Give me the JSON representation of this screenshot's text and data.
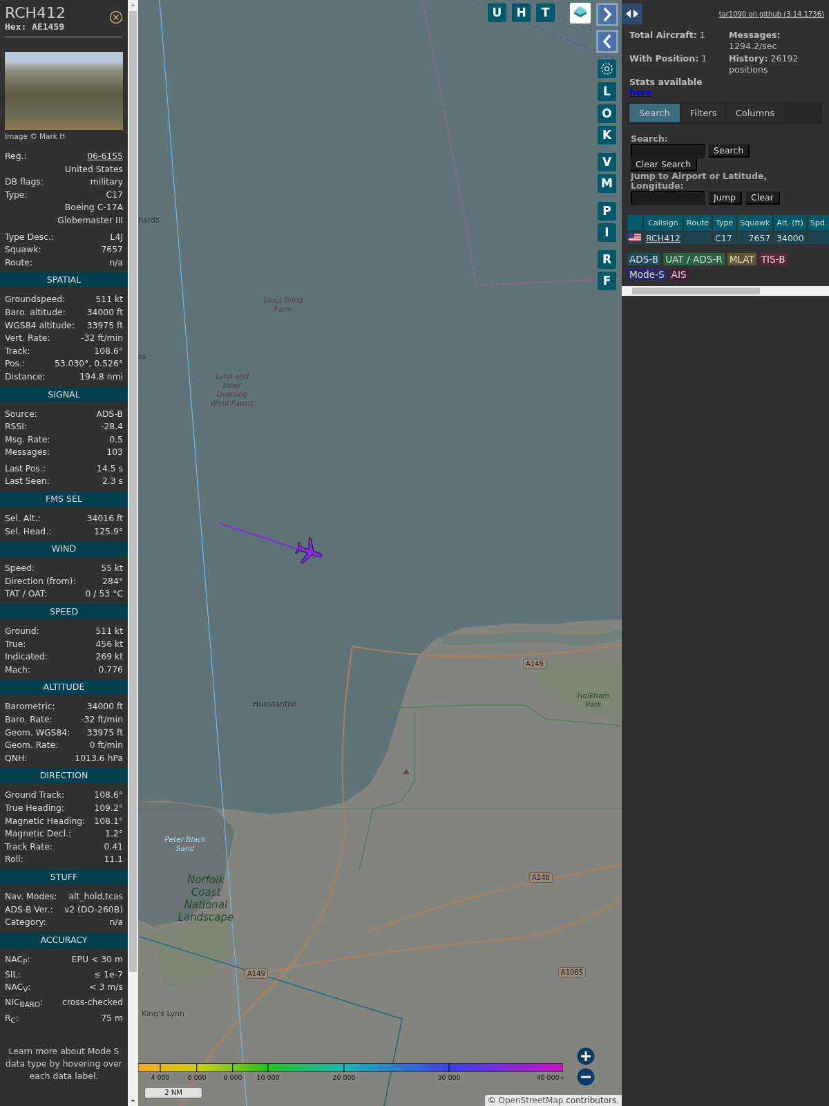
{
  "aircraft_panel": {
    "callsign": "RCH412",
    "hex": "Hex: AE1459",
    "photo_credit": "Image © Mark H",
    "details": [
      [
        {
          "kind": "link",
          "label": "Reg.:",
          "value": "06-6155"
        },
        {
          "kind": "plain",
          "value": "United States"
        },
        {
          "kind": "plain",
          "label": "DB flags:",
          "value": "military"
        },
        {
          "kind": "plain",
          "label": "Type:",
          "value": "C17"
        },
        {
          "kind": "plain",
          "value": "Boeing C-17A Globemaster III"
        }
      ],
      [
        {
          "kind": "plain",
          "label": "Type Desc.:",
          "value": "L4J"
        },
        {
          "kind": "plain",
          "label": "Squawk:",
          "value": "7657"
        },
        {
          "kind": "plain",
          "label": "Route:",
          "value": "n/a"
        }
      ]
    ],
    "sections": [
      {
        "title": "SPATIAL",
        "groups": [
          [
            {
              "label": "Groundspeed:",
              "value": "511 kt"
            },
            {
              "label": "Baro. altitude:",
              "value": "34000 ft"
            },
            {
              "label": "WGS84 altitude:",
              "value": "33975 ft"
            },
            {
              "label": "Vert. Rate:",
              "value": "-32 ft/min"
            },
            {
              "label": "Track:",
              "value": "108.6°"
            },
            {
              "label": "Pos.:",
              "value": "53.030°, 0.526°"
            },
            {
              "label": "Distance:",
              "value": "194.8 nmi"
            }
          ]
        ]
      },
      {
        "title": "SIGNAL",
        "groups": [
          [
            {
              "label": "Source:",
              "value": "ADS-B"
            },
            {
              "label": "RSSI:",
              "value": "-28.4"
            },
            {
              "label": "Msg. Rate:",
              "value": "0.5"
            },
            {
              "label": "Messages:",
              "value": "103"
            }
          ],
          [
            {
              "label": "Last Pos.:",
              "value": "14.5 s"
            },
            {
              "label": "Last Seen:",
              "value": "2.3 s"
            }
          ]
        ]
      },
      {
        "title": "FMS SEL",
        "groups": [
          [
            {
              "label": "Sel. Alt.:",
              "value": "34016 ft"
            },
            {
              "label": "Sel. Head.:",
              "value": "125.9°"
            }
          ]
        ]
      },
      {
        "title": "WIND",
        "groups": [
          [
            {
              "label": "Speed:",
              "value": "55 kt"
            },
            {
              "label": "Direction (from):",
              "value": "284°"
            },
            {
              "label": "TAT / OAT:",
              "value": "0 / 53 °C"
            }
          ]
        ]
      },
      {
        "title": "SPEED",
        "groups": [
          [
            {
              "label": "Ground:",
              "value": "511 kt"
            },
            {
              "label": "True:",
              "value": "456 kt"
            },
            {
              "label": "Indicated:",
              "value": "269 kt"
            },
            {
              "label": "Mach:",
              "value": "0.776"
            }
          ]
        ]
      },
      {
        "title": "ALTITUDE",
        "groups": [
          [
            {
              "label": "Barometric:",
              "value": "34000 ft"
            },
            {
              "label": "Baro. Rate:",
              "value": "-32 ft/min"
            },
            {
              "label": "Geom. WGS84:",
              "value": "33975 ft"
            },
            {
              "label": "Geom. Rate:",
              "value": "0 ft/min"
            },
            {
              "label": "QNH:",
              "value": "1013.6 hPa"
            }
          ]
        ]
      },
      {
        "title": "DIRECTION",
        "groups": [
          [
            {
              "label": "Ground Track:",
              "value": "108.6°"
            },
            {
              "label": "True Heading:",
              "value": "109.2°"
            },
            {
              "label": "Magnetic Heading:",
              "value": "108.1°"
            },
            {
              "label": "Magnetic Decl.:",
              "value": "1.2°"
            },
            {
              "label": "Track Rate:",
              "value": "0.41"
            },
            {
              "label": "Roll:",
              "value": "11.1"
            }
          ]
        ]
      },
      {
        "title": "STUFF",
        "groups": [
          [
            {
              "label": "Nav. Modes:",
              "value": "alt_hold,tcas"
            },
            {
              "label": "ADS-B Ver.:",
              "value": "v2 (DO-260B)"
            },
            {
              "label": "Category:",
              "value": "n/a"
            }
          ]
        ]
      },
      {
        "title": "ACCURACY",
        "groups": [
          [
            {
              "label": "NAC$_{P}$:",
              "value": "EPU < 30 m"
            },
            {
              "label": "SIL:",
              "value": "≤ 1e-7"
            },
            {
              "label": "NAC$_{V}$:",
              "value": "< 3 m/s"
            },
            {
              "label": "NIC$_{BARO}$:",
              "value": "cross-checked"
            },
            {
              "label": "R$_{C}$:",
              "value": "75 m"
            }
          ]
        ]
      }
    ],
    "footnote": "Learn more about Mode S data type by hovering over each data label."
  },
  "map": {
    "labels": [
      {
        "text": "hards",
        "kind": "town"
      },
      {
        "text": "ss",
        "kind": "town"
      },
      {
        "text": "Lincs Wind Farm",
        "kind": "feature"
      },
      {
        "text": "Lynn and Inner Dowsing Wind Farms",
        "kind": "feature"
      },
      {
        "text": "A149",
        "kind": "road"
      },
      {
        "text": "Hunstanton",
        "kind": "town"
      },
      {
        "text": "Holkham Park",
        "kind": "park"
      },
      {
        "text": "Peter Black Sand",
        "kind": "water"
      },
      {
        "text": "A148",
        "kind": "road"
      },
      {
        "text": "Norfolk Coast National Landscape",
        "kind": "park_big"
      },
      {
        "text": "A1065",
        "kind": "road"
      },
      {
        "text": "A149",
        "kind": "road"
      },
      {
        "text": "King's Lynn",
        "kind": "town"
      }
    ],
    "top_buttons": [
      "U",
      "H",
      "T"
    ],
    "side_buttons": [
      "L",
      "O",
      "K",
      "V",
      "M",
      "P",
      "I",
      "R",
      "F"
    ],
    "altitude_legend": [
      "4 000",
      "6 000",
      "8 000",
      "10 000",
      "20 000",
      "30 000",
      "40 000+"
    ],
    "scale": "2 NM",
    "attribution": {
      "prefix": "© ",
      "link": "OpenStreetMap",
      "suffix": " contributors."
    }
  },
  "side_panel": {
    "github_link": "tar1090 on github (3.14.1736)",
    "stats": [
      "**Total Aircraft:** 1",
      "**Messages:** 1294.2/sec",
      "**With Position:** 1",
      "**History:** 26192 positions"
    ],
    "stats_note": "Stats available",
    "stats_link": "here",
    "tabs": [
      {
        "label": "Search",
        "selected": true
      },
      {
        "label": "Filters",
        "selected": false
      },
      {
        "label": "Columns",
        "selected": false
      }
    ],
    "search_label": "Search:",
    "search_button": "Search",
    "clear_search_button": "Clear Search",
    "jump_label": "Jump to Airport or Latitude, Longitude:",
    "jump_button": "Jump",
    "clear_button": "Clear",
    "table": {
      "columns": [
        "Callsign",
        "Route",
        "Type",
        "Squawk",
        "Alt. (ft)",
        "Spd."
      ],
      "rows": [
        {
          "cells": [
            "RCH412",
            null,
            "C17",
            "7657",
            "34000",
            null
          ]
        }
      ]
    },
    "sources": [
      {
        "label": "ADS-B",
        "color": "#1f4a5a"
      },
      {
        "label": "UAT / ADS-R",
        "color": "#2a6040"
      },
      {
        "label": "MLAT",
        "color": "#5f5630"
      },
      {
        "label": "TIS-B",
        "color": "#5c2838"
      },
      {
        "label": "Mode-S",
        "color": "#2a2a66"
      },
      {
        "label": "AIS",
        "color": "#45203a"
      }
    ]
  }
}
